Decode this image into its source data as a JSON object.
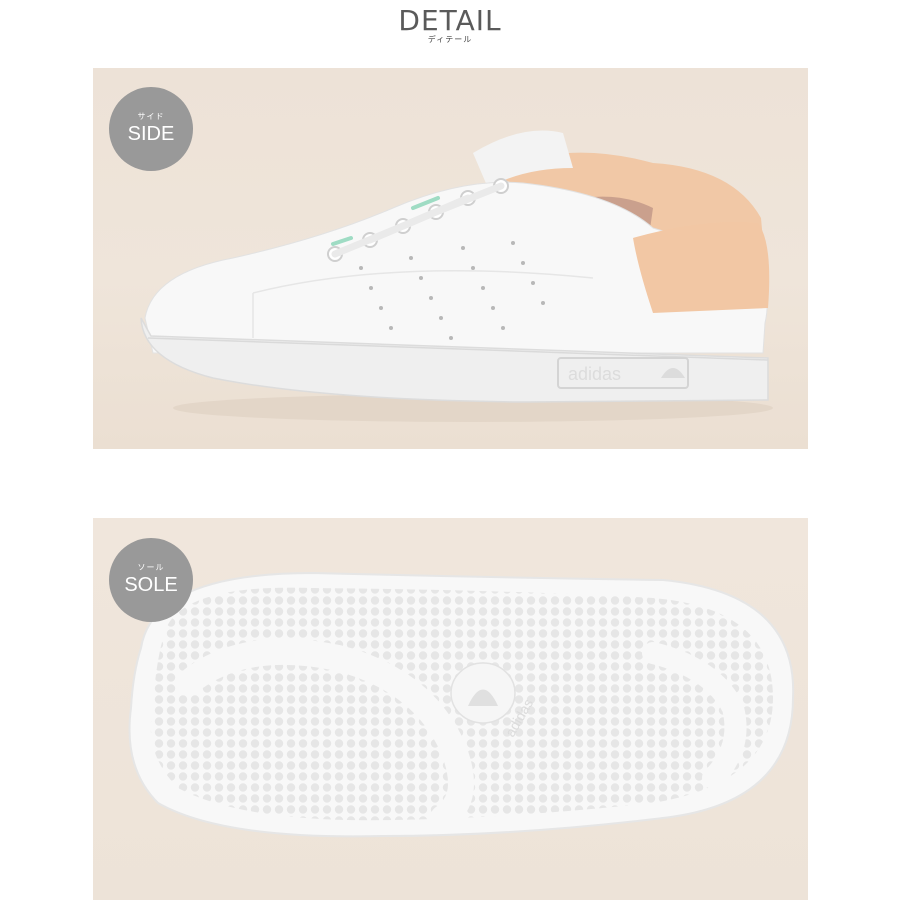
{
  "header": {
    "title": "DETAIL",
    "subtitle": "ディテール"
  },
  "panels": {
    "side": {
      "badge_kana": "サイド",
      "badge_label": "SIDE",
      "brand_text": "adidas"
    },
    "sole": {
      "badge_kana": "ソール",
      "badge_label": "SOLE",
      "brand_text": "adidas"
    }
  },
  "colors": {
    "background": "#ffffff",
    "panel_bg": "#eee4d9",
    "badge": "#999999",
    "shoe_white": "#f7f7f7",
    "heel_tab": "#f2c9a7",
    "lace_accent": "#9fdcc4"
  }
}
